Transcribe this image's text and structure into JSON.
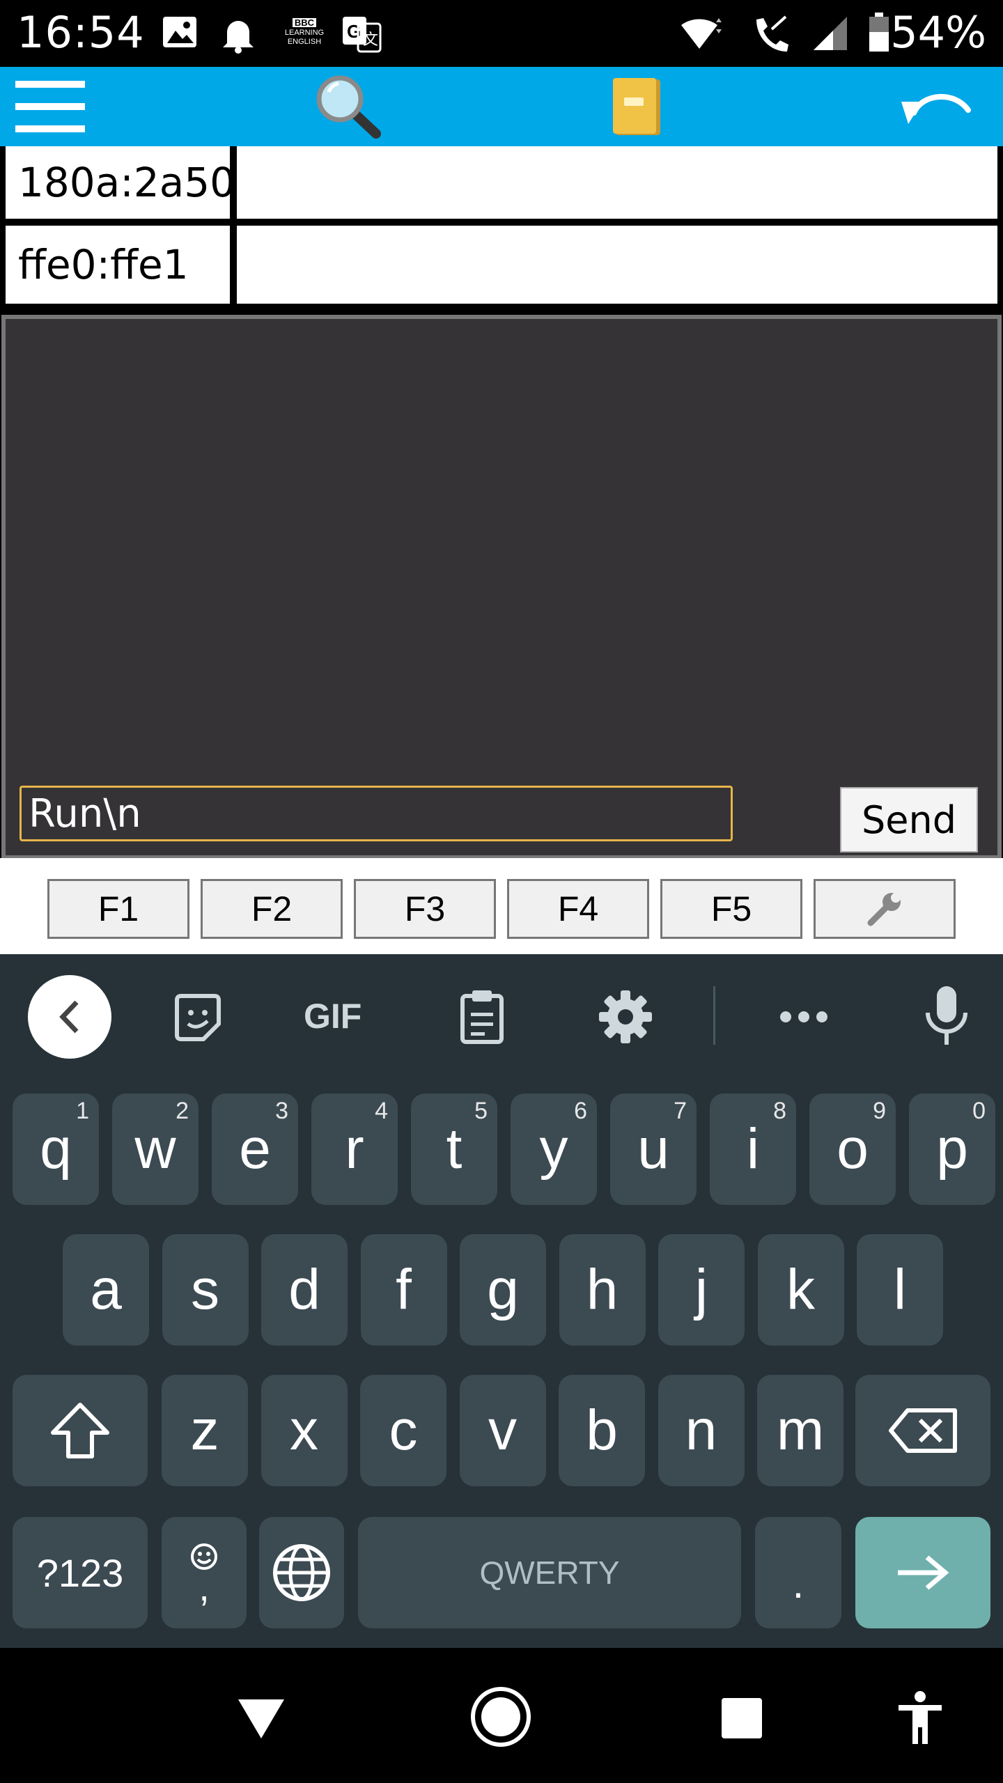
{
  "status_bar": {
    "time": "16:54",
    "battery": "54%",
    "bbc_line1": "BBC",
    "bbc_line2": "LEARNING",
    "bbc_line3": "ENGLISH"
  },
  "app_bar": {
    "icons": [
      "menu-icon",
      "search-icon",
      "notebook-icon",
      "undo-icon"
    ],
    "color": "#00a8e8"
  },
  "table": {
    "rows": [
      {
        "key": "180a:2a50",
        "value": ""
      },
      {
        "key": "ffe0:ffe1",
        "value": ""
      }
    ]
  },
  "terminal": {
    "input_value": "Run\\n",
    "send_label": "Send"
  },
  "function_keys": [
    "F1",
    "F2",
    "F3",
    "F4",
    "F5"
  ],
  "keyboard": {
    "toolbar_gif": "GIF",
    "row1": [
      {
        "l": "q",
        "n": "1"
      },
      {
        "l": "w",
        "n": "2"
      },
      {
        "l": "e",
        "n": "3"
      },
      {
        "l": "r",
        "n": "4"
      },
      {
        "l": "t",
        "n": "5"
      },
      {
        "l": "y",
        "n": "6"
      },
      {
        "l": "u",
        "n": "7"
      },
      {
        "l": "i",
        "n": "8"
      },
      {
        "l": "o",
        "n": "9"
      },
      {
        "l": "p",
        "n": "0"
      }
    ],
    "row2": [
      "a",
      "s",
      "d",
      "f",
      "g",
      "h",
      "j",
      "k",
      "l"
    ],
    "row3": [
      "z",
      "x",
      "c",
      "v",
      "b",
      "n",
      "m"
    ],
    "symbols_label": "?123",
    "comma_label": ",",
    "space_label": "QWERTY",
    "period_label": "."
  }
}
